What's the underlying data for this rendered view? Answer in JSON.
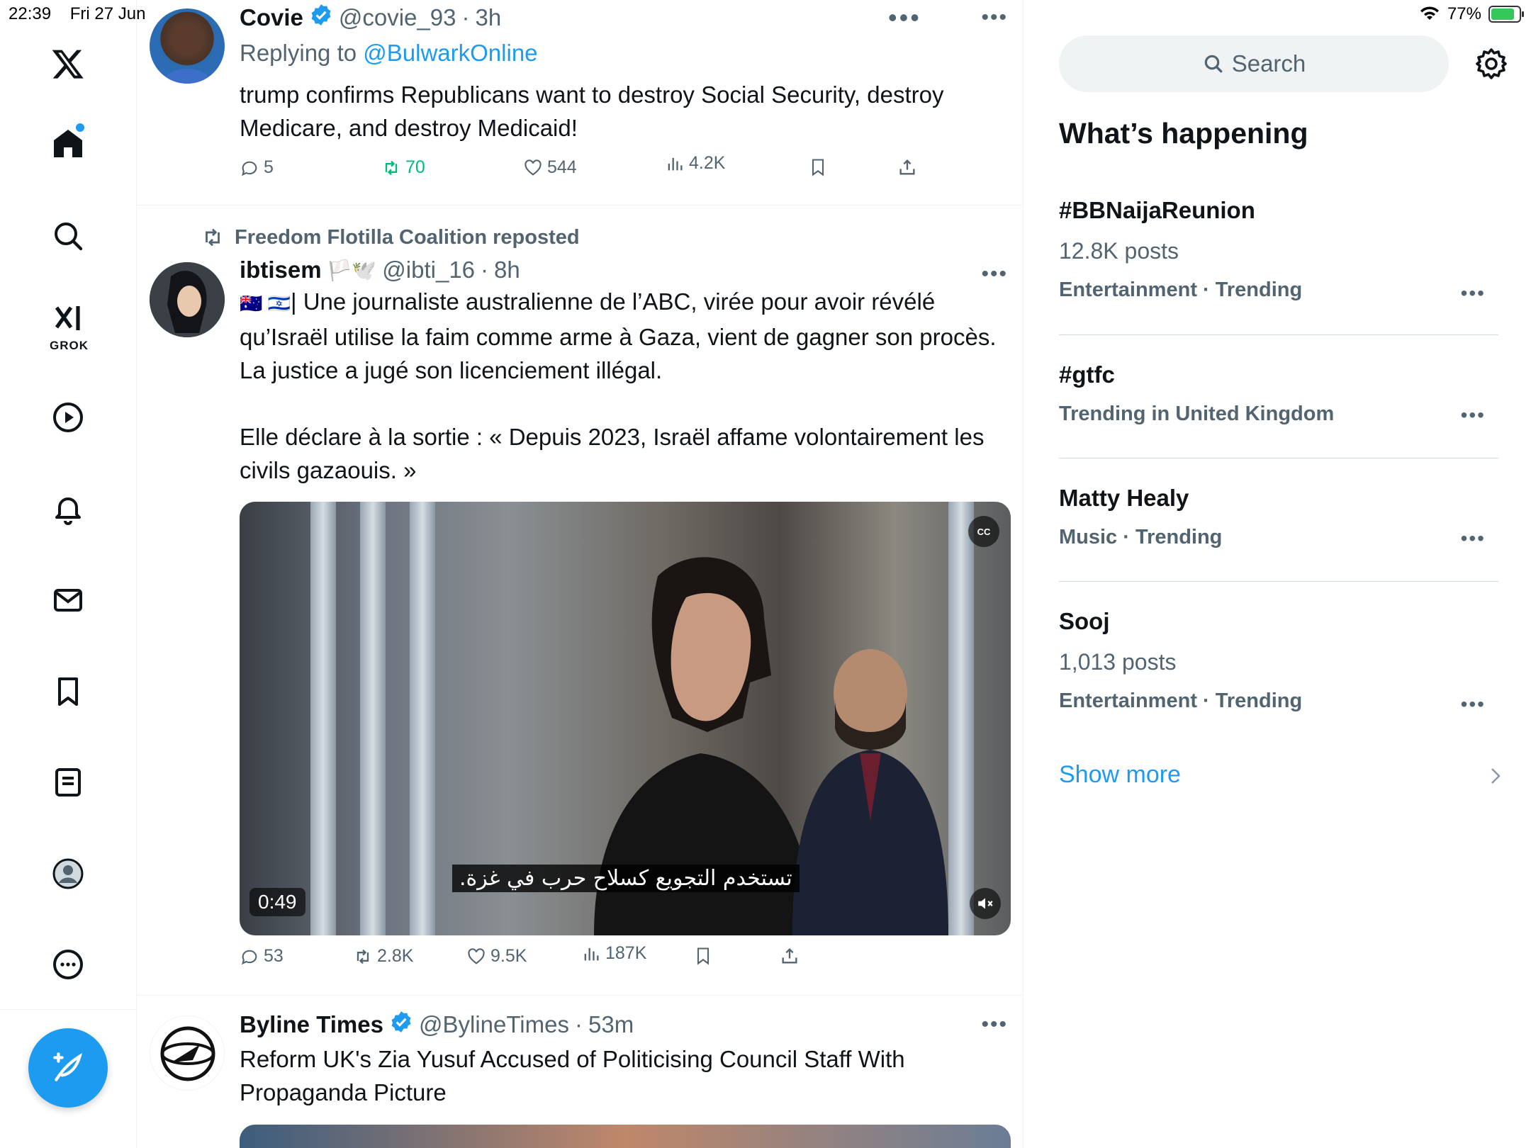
{
  "status_bar": {
    "time": "22:39",
    "date": "Fri 27 Jun",
    "battery": "77%"
  },
  "nav": {
    "grok_label": "GROK"
  },
  "tweets": [
    {
      "name": "Covie",
      "handle": "@covie_93",
      "time": "3h",
      "replying_prefix": "Replying to ",
      "replying_to": "@BulwarkOnline",
      "text": "trump confirms Republicans want to destroy Social Security, destroy Medicare, and destroy Medicaid!",
      "replies": "5",
      "reposts": "70",
      "likes": "544",
      "views": "4.2K"
    },
    {
      "reposted_by": "Freedom Flotilla Coalition reposted",
      "name": "ibtisem",
      "name_emoji": "🏳️🕊️",
      "handle": "@ibti_16",
      "time": "8h",
      "flags": "🇦🇺 🇮🇱",
      "text": "| Une journaliste australienne de l’ABC, virée pour avoir révélé qu’Israël utilise la faim comme arme à Gaza, vient de gagner son procès. La justice a jugé son licenciement illégal.\n\nElle déclare à la sortie : « Depuis 2023, Israël affame volontairement les civils gazaouis. »",
      "video_caption": "تستخدم التجويع كسلاح حرب في غزة.",
      "video_duration": "0:49",
      "replies": "53",
      "reposts": "2.8K",
      "likes": "9.5K",
      "views": "187K"
    },
    {
      "name": "Byline Times",
      "handle": "@BylineTimes",
      "time": "53m",
      "text": "Reform UK's Zia Yusuf Accused of Politicising Council Staff With Propaganda Picture"
    }
  ],
  "sidebar": {
    "search_placeholder": "Search",
    "title": "What’s happening",
    "trends": [
      {
        "title": "#BBNaijaReunion",
        "posts": "12.8K posts",
        "meta": "Entertainment · Trending"
      },
      {
        "title": "#gtfc",
        "posts": "",
        "meta": "Trending in United Kingdom"
      },
      {
        "title": "Matty Healy",
        "posts": "",
        "meta": "Music · Trending"
      },
      {
        "title": "Sooj",
        "posts": "1,013 posts",
        "meta": "Entertainment · Trending"
      }
    ],
    "show_more": "Show more"
  },
  "colors": {
    "accent": "#1d9bf0",
    "muted": "#536471",
    "repost_active": "#00ba7c"
  }
}
